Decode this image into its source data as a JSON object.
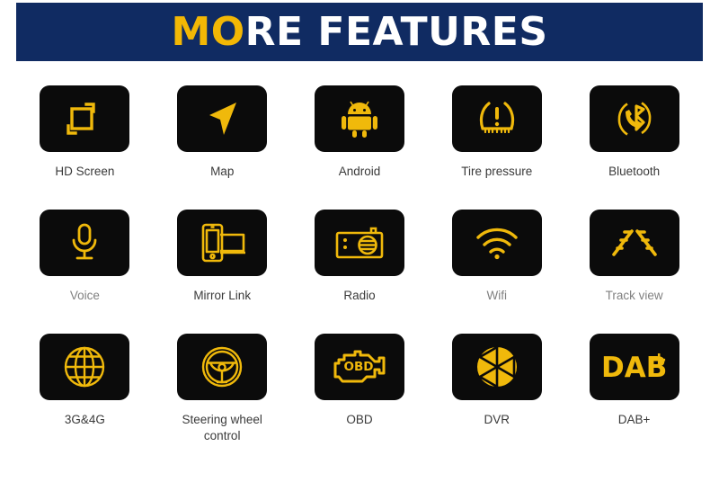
{
  "header": {
    "title_gold": "MO",
    "title_white": "RE FEATURES",
    "full_title": "MORE FEATURES",
    "band_color": "#102b62",
    "gold": "#f2b705",
    "white": "#ffffff"
  },
  "theme": {
    "tile_bg": "#0b0b0b",
    "icon_gold": "#f0b90b",
    "label_dark": "#3a3a3a",
    "label_muted": "#808080",
    "page_bg": "#ffffff"
  },
  "features": [
    {
      "label": "HD Screen",
      "icon": "hd-screen-icon",
      "muted": false
    },
    {
      "label": "Map",
      "icon": "navigation-arrow-icon",
      "muted": false
    },
    {
      "label": "Android",
      "icon": "android-robot-icon",
      "muted": false
    },
    {
      "label": "Tire pressure",
      "icon": "tire-pressure-icon",
      "muted": false
    },
    {
      "label": "Bluetooth",
      "icon": "bluetooth-phone-icon",
      "muted": false
    },
    {
      "label": "Voice",
      "icon": "microphone-icon",
      "muted": true
    },
    {
      "label": "Mirror Link",
      "icon": "mirror-link-icon",
      "muted": false
    },
    {
      "label": "Radio",
      "icon": "radio-icon",
      "muted": false
    },
    {
      "label": "Wifi",
      "icon": "wifi-icon",
      "muted": true
    },
    {
      "label": "Track view",
      "icon": "track-view-icon",
      "muted": true
    },
    {
      "label": "3G&4G",
      "icon": "globe-icon",
      "muted": false
    },
    {
      "label": "Steering wheel control",
      "icon": "steering-wheel-icon",
      "muted": false
    },
    {
      "label": "OBD",
      "icon": "obd-engine-icon",
      "muted": false
    },
    {
      "label": "DVR",
      "icon": "camera-shutter-icon",
      "muted": false
    },
    {
      "label": "DAB+",
      "icon": "dab-plus-icon",
      "muted": false
    }
  ],
  "icon_text": {
    "obd": "OBD",
    "dab": "DAB",
    "dab_plus": "+"
  }
}
